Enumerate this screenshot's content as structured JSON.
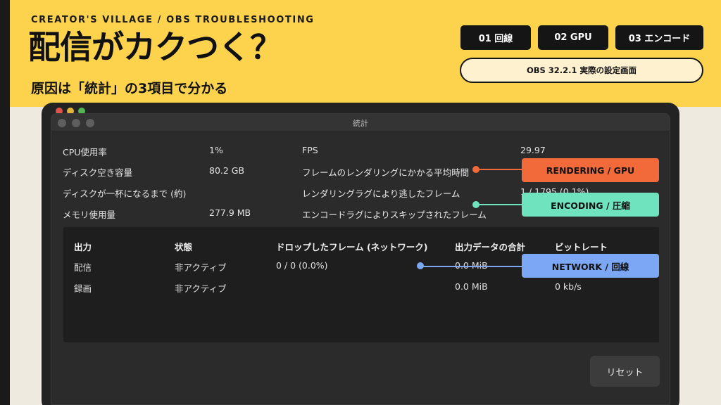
{
  "header": {
    "kicker": "CREATOR'S VILLAGE / OBS TROUBLESHOOTING",
    "title": "配信がカクつく？",
    "subtitle": "原因は「統計」の3項目で分かる"
  },
  "tags": [
    {
      "label": "01 回線"
    },
    {
      "label": "02 GPU"
    },
    {
      "label": "03 エンコード"
    }
  ],
  "version_badge": "OBS 32.2.1 実際の設定画面",
  "window": {
    "title": "統計",
    "reset_label": "リセット"
  },
  "stats_left": [
    {
      "label": "CPU使用率",
      "value": "1%"
    },
    {
      "label": "ディスク空き容量",
      "value": "80.2 GB"
    },
    {
      "label": "ディスクが一杯になるまで (約)",
      "value": ""
    },
    {
      "label": "メモリ使用量",
      "value": "277.9 MB"
    }
  ],
  "stats_right": [
    {
      "label": "FPS",
      "value": "29.97"
    },
    {
      "label": "フレームのレンダリングにかかる平均時間",
      "value": ""
    },
    {
      "label": "レンダリングラグにより逃したフレーム",
      "value": "1 / 1795 (0.1%)"
    },
    {
      "label": "エンコードラグによりスキップされたフレーム",
      "value": ""
    }
  ],
  "outputs_table": {
    "headers": [
      "出力",
      "状態",
      "ドロップしたフレーム (ネットワーク)",
      "出力データの合計",
      "ビットレート"
    ],
    "rows": [
      {
        "output": "配信",
        "status": "非アクティブ",
        "dropped": "0 / 0 (0.0%)",
        "total": "0.0 MiB",
        "bitrate": ""
      },
      {
        "output": "録画",
        "status": "非アクティブ",
        "dropped": "",
        "total": "0.0 MiB",
        "bitrate": "0 kb/s"
      }
    ]
  },
  "callouts": {
    "rendering": {
      "label": "RENDERING / GPU",
      "color": "#f26a3a"
    },
    "encoding": {
      "label": "ENCODING / 圧縮",
      "color": "#6fe3bd"
    },
    "network": {
      "label": "NETWORK / 回線",
      "color": "#7ba7f5"
    }
  },
  "colors": {
    "brand_yellow": "#fdd34e",
    "dark": "#151515"
  }
}
